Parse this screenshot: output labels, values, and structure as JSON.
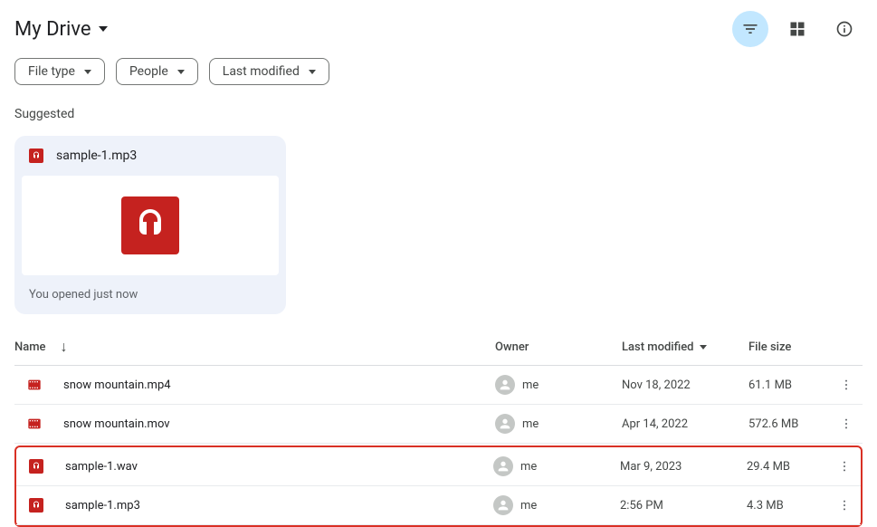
{
  "header": {
    "title": "My Drive"
  },
  "filters": {
    "file_type": "File type",
    "people": "People",
    "last_modified": "Last modified"
  },
  "suggested": {
    "label": "Suggested",
    "card": {
      "name": "sample-1.mp3",
      "footer": "You opened just now"
    }
  },
  "columns": {
    "name": "Name",
    "owner": "Owner",
    "modified": "Last modified",
    "size": "File size"
  },
  "rows": [
    {
      "icon": "video",
      "name": "snow mountain.mp4",
      "owner": "me",
      "modified": "Nov 18, 2022",
      "size": "61.1 MB"
    },
    {
      "icon": "video",
      "name": "snow mountain.mov",
      "owner": "me",
      "modified": "Apr 14, 2022",
      "size": "572.6 MB"
    },
    {
      "icon": "audio",
      "name": "sample-1.wav",
      "owner": "me",
      "modified": "Mar 9, 2023",
      "size": "29.4 MB"
    },
    {
      "icon": "audio",
      "name": "sample-1.mp3",
      "owner": "me",
      "modified": "2:56 PM",
      "size": "4.3 MB"
    }
  ]
}
